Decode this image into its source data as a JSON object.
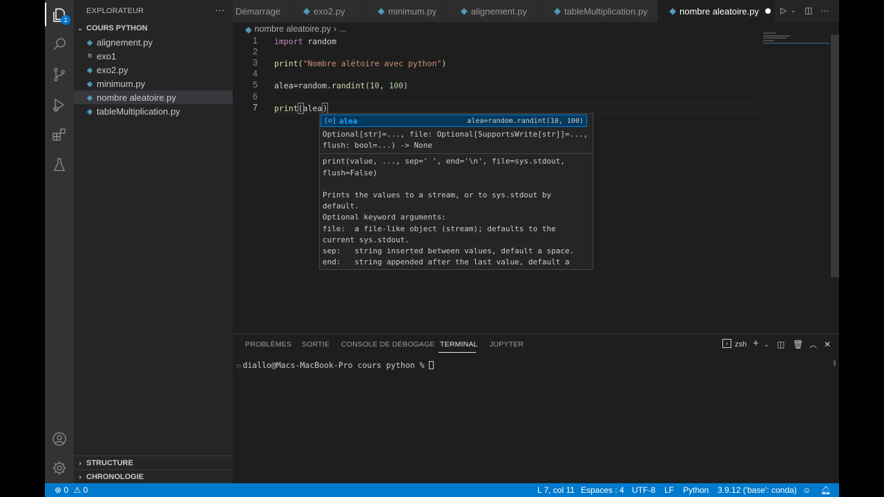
{
  "sidebar": {
    "title": "EXPLORATEUR",
    "more_label": "···",
    "folder": "COURS PYTHON",
    "files": [
      {
        "name": "alignement.py",
        "icon": "python-file-icon"
      },
      {
        "name": "exo1",
        "icon": "text-file-icon"
      },
      {
        "name": "exo2.py",
        "icon": "python-file-icon"
      },
      {
        "name": "minimum.py",
        "icon": "python-file-icon"
      },
      {
        "name": "nombre aleatoire.py",
        "icon": "python-file-icon",
        "selected": true
      },
      {
        "name": "tableMultiplication.py",
        "icon": "python-file-icon"
      }
    ],
    "structure": "STRUCTURE",
    "timeline": "CHRONOLOGIE"
  },
  "activity": {
    "explorer_badge": "1"
  },
  "tabs": [
    {
      "label": "Démarrage"
    },
    {
      "label": "exo2.py"
    },
    {
      "label": "minimum.py"
    },
    {
      "label": "alignement.py"
    },
    {
      "label": "tableMultiplication.py"
    },
    {
      "label": "nombre aleatoire.py",
      "active": true,
      "dirty": true
    }
  ],
  "breadcrumb": {
    "file": "nombre aleatoire.py",
    "sep": "›",
    "rest": "..."
  },
  "editor": {
    "line_numbers": [
      "1",
      "2",
      "3",
      "4",
      "5",
      "6",
      "7"
    ],
    "current_line": 7,
    "lines": [
      {
        "t1": "import",
        "t2": " random"
      },
      {},
      {
        "fn": "print",
        "p1": "(",
        "s": "\"Nombre alétoire avec python\"",
        "p2": ")"
      },
      {},
      {
        "a": "alea=random.",
        "fn": "randint",
        "p1": "(",
        "n1": "10",
        "c": ", ",
        "n2": "100",
        "p2": ")"
      },
      {},
      {
        "fn": "print",
        "p1": "(",
        "v": "alea",
        "p2": ")"
      }
    ]
  },
  "suggest": {
    "icon_label": "[⊘]",
    "label": "alea",
    "detail": "alea=random.randint(10, 100)",
    "signature": "Optional[str]=..., file: Optional[SupportsWrite[str]]=...,\nflush: bool=...) -> None",
    "doc": "print(value, ..., sep=' ', end='\\n', file=sys.stdout,\nflush=False)\n\nPrints the values to a stream, or to sys.stdout by\ndefault.\nOptional keyword arguments:\nfile:  a file-like object (stream); defaults to the\ncurrent sys.stdout.\nsep:   string inserted between values, default a space.\nend:   string appended after the last value, default a\nnewline."
  },
  "panel": {
    "tabs": [
      "PROBLÈMES",
      "SORTIE",
      "CONSOLE DE DÉBOGAGE",
      "TERMINAL",
      "JUPYTER"
    ],
    "active_tab": "TERMINAL",
    "shell": "zsh",
    "prompt": "diallo@Macs-MacBook-Pro cours python % "
  },
  "statusbar": {
    "errors": "0",
    "warnings": "0",
    "position": "L 7, col 11",
    "spaces": "Espaces : 4",
    "encoding": "UTF-8",
    "eol": "LF",
    "language": "Python",
    "interpreter": "3.9.12 ('base': conda)"
  },
  "colors": {
    "accent": "#007acc",
    "selection": "#04395e"
  }
}
